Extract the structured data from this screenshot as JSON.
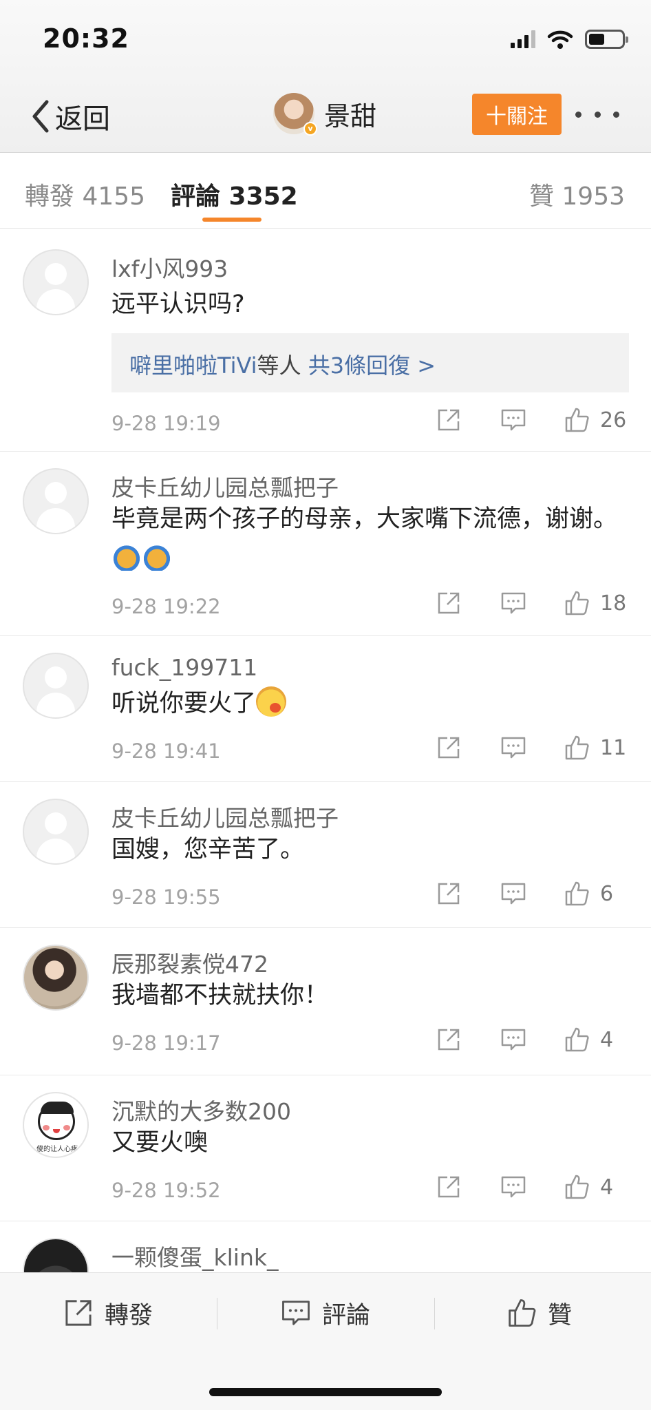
{
  "status": {
    "time": "20:32"
  },
  "nav": {
    "back_label": "返回",
    "profile_name": "景甜",
    "follow_label": "十關注"
  },
  "tabs": [
    {
      "label": "轉發 4155"
    },
    {
      "label": "評論 3352"
    },
    {
      "label": "贊 1953"
    }
  ],
  "active_tab": "評論 3352",
  "comments": [
    {
      "user": "lxf小风993",
      "text": "远平认识吗?",
      "reply": {
        "name": "噼里啪啦TiVi",
        "mid": "等人 ",
        "count": "共3條回復 >"
      },
      "time": "9-28 19:19",
      "likes": "26",
      "avatar": "placeholder"
    },
    {
      "user": "皮卡丘幼儿园总瓢把子",
      "text": "毕竟是两个孩子的母亲，大家嘴下流德，谢谢。",
      "emoji": "folded-hands-emoji",
      "time": "9-28 19:22",
      "likes": "18",
      "avatar": "placeholder"
    },
    {
      "user": "fuck_199711",
      "text": "听说你要火了",
      "emoji": "blushing-emoji",
      "time": "9-28 19:41",
      "likes": "11",
      "avatar": "placeholder"
    },
    {
      "user": "皮卡丘幼儿园总瓢把子",
      "text": "国嫂，您辛苦了。",
      "time": "9-28 19:55",
      "likes": "6",
      "avatar": "placeholder"
    },
    {
      "user": "辰那裂素傥472",
      "text": "我墙都不扶就扶你！",
      "time": "9-28 19:17",
      "likes": "4",
      "avatar": "photo"
    },
    {
      "user": "沉默的大多数200",
      "text": "又要火噢",
      "time": "9-28 19:52",
      "likes": "4",
      "avatar": "cartoon",
      "avatar_caption": "傻的让人心疼"
    },
    {
      "user": "一颗傻蛋_klink_",
      "avatar": "photo"
    }
  ],
  "bottom_bar": {
    "repost_label": "轉發",
    "comment_label": "評論",
    "like_label": "贊"
  },
  "colors": {
    "accent": "#f5862b",
    "link": "#4a6fa5"
  }
}
